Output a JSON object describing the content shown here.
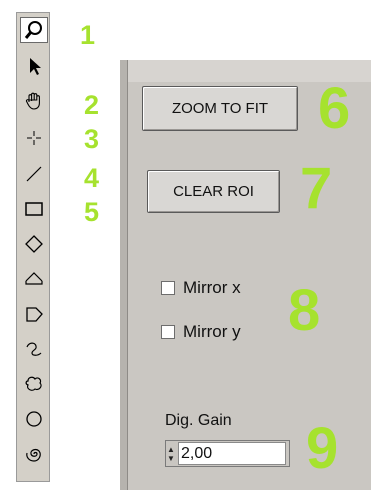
{
  "tool_palette": {
    "tools": [
      {
        "name": "zoom-tool",
        "icon": "magnifier-icon"
      },
      {
        "name": "select-tool",
        "icon": "arrow-pointer-icon"
      },
      {
        "name": "pan-tool",
        "icon": "hand-icon"
      },
      {
        "name": "point-tool",
        "icon": "crosshair-icon"
      },
      {
        "name": "line-tool",
        "icon": "line-icon"
      },
      {
        "name": "rectangle-tool",
        "icon": "rectangle-icon"
      },
      {
        "name": "rotated-rectangle-tool",
        "icon": "diamond-icon"
      },
      {
        "name": "annulus-tool",
        "icon": "arc-icon"
      },
      {
        "name": "polygon-tool",
        "icon": "polygon-icon"
      },
      {
        "name": "freehand-line-tool",
        "icon": "freehand-icon"
      },
      {
        "name": "freehand-region-tool",
        "icon": "freehand-region-icon"
      },
      {
        "name": "oval-tool",
        "icon": "oval-icon"
      },
      {
        "name": "spiral-tool",
        "icon": "spiral-icon"
      }
    ],
    "active_index": 0
  },
  "callouts": {
    "n1": "1",
    "n2": "2",
    "n3": "3",
    "n4": "4",
    "n5": "5",
    "n6": "6",
    "n7": "7",
    "n8": "8",
    "n9": "9",
    "color": "#a6e22e"
  },
  "controls": {
    "zoom_to_fit_label": "ZOOM TO FIT",
    "clear_roi_label": "CLEAR ROI",
    "mirror_x_label": "Mirror x",
    "mirror_x_checked": false,
    "mirror_y_label": "Mirror y",
    "mirror_y_checked": false,
    "dig_gain_label": "Dig. Gain",
    "dig_gain_value": "2,00"
  }
}
